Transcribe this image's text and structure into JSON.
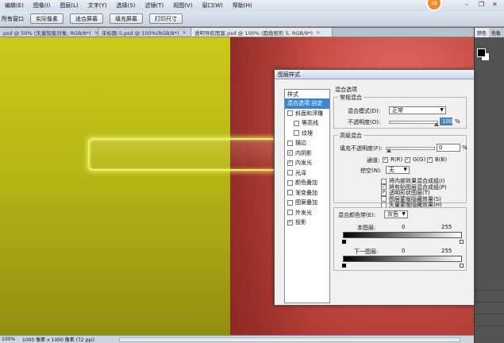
{
  "menubar": {
    "items": [
      "编辑(E)",
      "图像(I)",
      "图层(L)",
      "文字(Y)",
      "选择(S)",
      "滤镜(T)",
      "视图(V)",
      "窗口(W)",
      "帮助(H)"
    ],
    "badge": "28"
  },
  "options_bar": {
    "label": "所有窗口",
    "buttons": [
      "实际像素",
      "适合屏幕",
      "填充屏幕",
      "打印尺寸"
    ]
  },
  "tabs": [
    {
      "label": "psd @ 50% (矢量智能对象, RGB/8*)",
      "active": false
    },
    {
      "label": "未标题-5.psd @ 100%(RGB/8*)",
      "active": false
    },
    {
      "label": "透明导航图案.psd @ 100% (圆角矩形 5, RGB/8*)",
      "active": true
    }
  ],
  "status_bar": {
    "zoom": "100%",
    "doc_info": "1000 像素 x 1000 像素 (72 ppi)"
  },
  "right_panel": {
    "tabs": [
      "颜色",
      "色板"
    ],
    "colors": {
      "foreground": "#000000",
      "background": "#ffffff"
    }
  },
  "dialog": {
    "title": "图层样式",
    "sidebar_header": "样式",
    "styles": [
      {
        "label": "混合选项:自定",
        "checkbox": false,
        "checked": false,
        "selected": true,
        "indent": false
      },
      {
        "label": "斜面和浮雕",
        "checkbox": true,
        "checked": false,
        "selected": false,
        "indent": false
      },
      {
        "label": "等高线",
        "checkbox": true,
        "checked": false,
        "selected": false,
        "indent": true
      },
      {
        "label": "纹理",
        "checkbox": true,
        "checked": false,
        "selected": false,
        "indent": true
      },
      {
        "label": "描边",
        "checkbox": true,
        "checked": false,
        "selected": false,
        "indent": false
      },
      {
        "label": "内阴影",
        "checkbox": true,
        "checked": true,
        "selected": false,
        "indent": false
      },
      {
        "label": "内发光",
        "checkbox": true,
        "checked": true,
        "selected": false,
        "indent": false
      },
      {
        "label": "光泽",
        "checkbox": true,
        "checked": false,
        "selected": false,
        "indent": false
      },
      {
        "label": "颜色叠加",
        "checkbox": true,
        "checked": false,
        "selected": false,
        "indent": false
      },
      {
        "label": "渐变叠加",
        "checkbox": true,
        "checked": false,
        "selected": false,
        "indent": false
      },
      {
        "label": "图案叠加",
        "checkbox": true,
        "checked": false,
        "selected": false,
        "indent": false
      },
      {
        "label": "外发光",
        "checkbox": true,
        "checked": false,
        "selected": false,
        "indent": false
      },
      {
        "label": "投影",
        "checkbox": true,
        "checked": true,
        "selected": false,
        "indent": false
      }
    ],
    "blend_options": {
      "section_title": "混合选项",
      "general": {
        "title": "常规混合",
        "mode_label": "混合模式(D):",
        "mode_value": "正常",
        "opacity_label": "不透明度(O):",
        "opacity_value": "100",
        "opacity_fraction": 1.0,
        "unit": "%"
      },
      "advanced": {
        "title": "高级混合",
        "fill_label": "填充不透明度(F):",
        "fill_value": "0",
        "fill_fraction": 0.0,
        "unit": "%",
        "channels_label": "通道:",
        "channels": [
          {
            "label": "R(R)",
            "checked": true
          },
          {
            "label": "G(G)",
            "checked": true
          },
          {
            "label": "B(B)",
            "checked": true
          }
        ],
        "knockout_label": "挖空(N):",
        "knockout_value": "无",
        "options": [
          {
            "label": "将内部效果混合成组(I)",
            "checked": false
          },
          {
            "label": "将剪贴图层混合成组(P)",
            "checked": true
          },
          {
            "label": "透明形状图层(T)",
            "checked": true
          },
          {
            "label": "图层蒙版隐藏效果(S)",
            "checked": false
          },
          {
            "label": "矢量蒙版隐藏效果(H)",
            "checked": false
          }
        ]
      },
      "blend_if": {
        "label": "混合颜色带(E):",
        "value": "灰色",
        "this_layer_label": "本图层:",
        "this_layer_min": "0",
        "this_layer_max": "255",
        "underlying_label": "下一图层:",
        "underlying_min": "0",
        "underlying_max": "255"
      }
    }
  }
}
